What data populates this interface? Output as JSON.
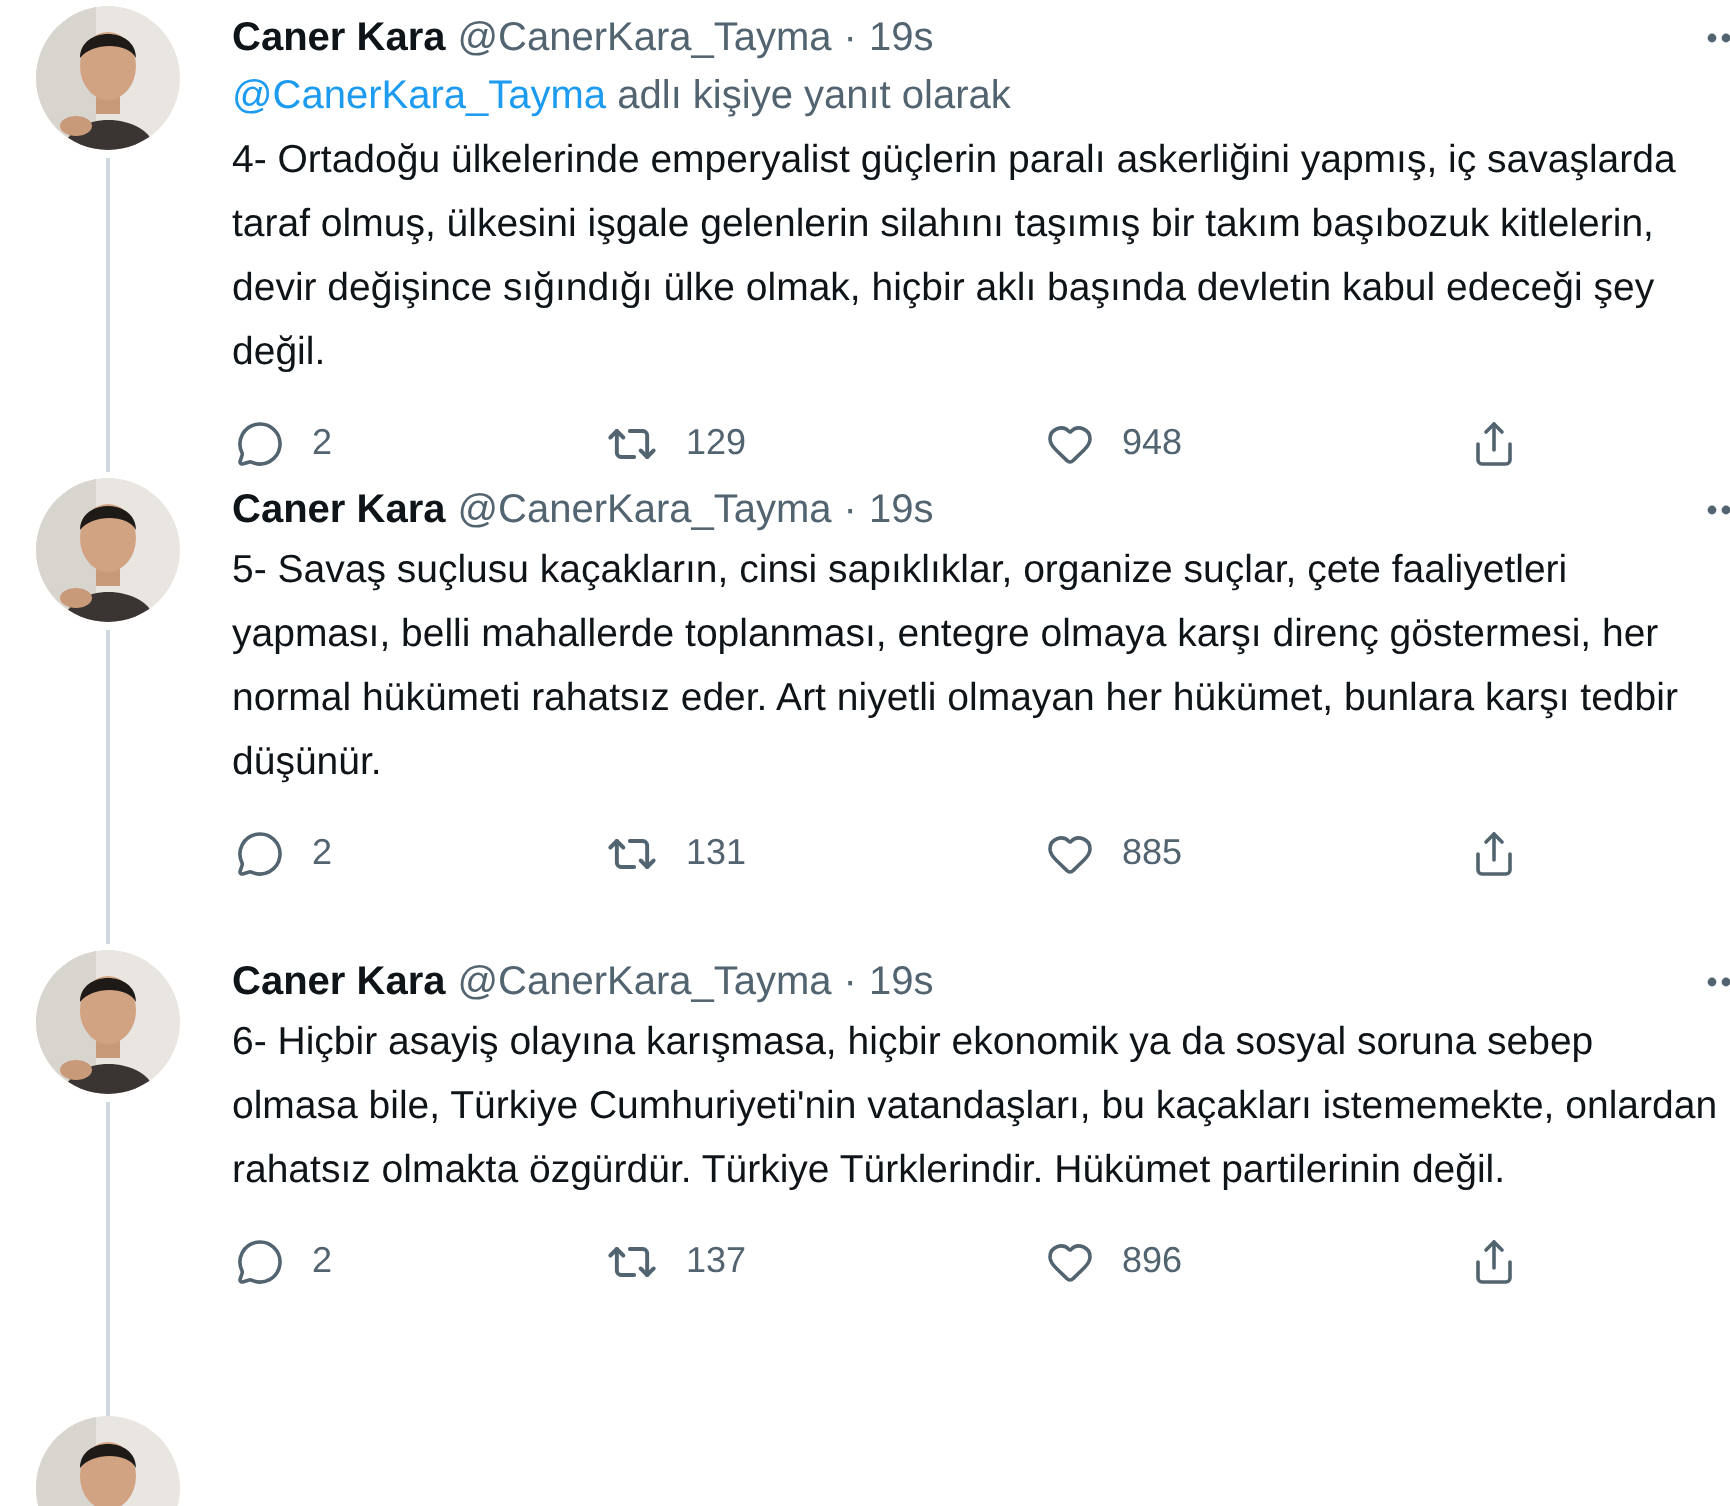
{
  "tweets": [
    {
      "name": "Caner Kara",
      "handle": "@CanerKara_Tayma",
      "dot": "·",
      "time": "19s",
      "reply_to": {
        "mention": "@CanerKara_Tayma",
        "suffix": "adlı kişiye yanıt olarak"
      },
      "text": "4- Ortadoğu ülkelerinde emperyalist güçlerin paralı askerliğini yapmış, iç savaşlarda taraf olmuş, ülkesini işgale gelenlerin silahını taşımış bir takım başıbozuk kitlelerin, devir değişince sığındığı ülke olmak, hiçbir aklı başında devletin kabul edeceği şey değil.",
      "replies": "2",
      "retweets": "129",
      "likes": "948"
    },
    {
      "name": "Caner Kara",
      "handle": "@CanerKara_Tayma",
      "dot": "·",
      "time": "19s",
      "text": "5- Savaş suçlusu kaçakların, cinsi sapıklıklar, organize suçlar, çete faaliyetleri yapması, belli mahallerde toplanması, entegre olmaya karşı direnç göstermesi, her normal hükümeti rahatsız eder. Art niyetli olmayan her hükümet, bunlara karşı tedbir düşünür.",
      "replies": "2",
      "retweets": "131",
      "likes": "885"
    },
    {
      "name": "Caner Kara",
      "handle": "@CanerKara_Tayma",
      "dot": "·",
      "time": "19s",
      "text": "6- Hiçbir asayiş olayına karışmasa, hiçbir ekonomik ya da sosyal soruna sebep olmasa bile, Türkiye Cumhuriyeti'nin vatandaşları, bu kaçakları istememekte, onlardan rahatsız olmakta özgürdür. Türkiye Türklerindir. Hükümet partilerinin değil.",
      "replies": "2",
      "retweets": "137",
      "likes": "896"
    }
  ]
}
